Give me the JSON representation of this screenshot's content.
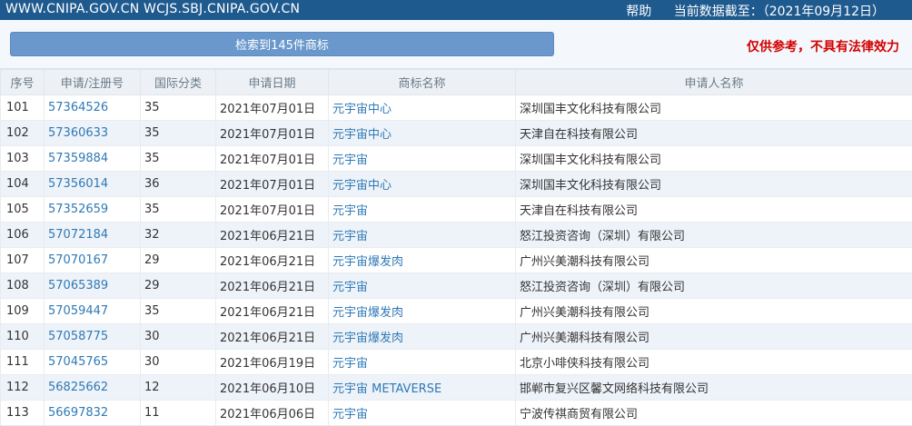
{
  "topbar": {
    "site": "WWW.CNIPA.GOV.CN WCJS.SBJ.CNIPA.GOV.CN",
    "help": "帮助",
    "data_as_of": "当前数据截至：（2021年09月12日）"
  },
  "result": {
    "count_label": "检索到145件商标",
    "disclaimer": "仅供参考，不具有法律效力"
  },
  "table": {
    "headers": [
      "序号",
      "申请/注册号",
      "国际分类",
      "申请日期",
      "商标名称",
      "申请人名称"
    ],
    "rows": [
      {
        "no": "101",
        "reg": "57364526",
        "cls": "35",
        "date": "2021年07月01日",
        "name": "元宇宙中心",
        "applicant": "深圳国丰文化科技有限公司"
      },
      {
        "no": "102",
        "reg": "57360633",
        "cls": "35",
        "date": "2021年07月01日",
        "name": "元宇宙中心",
        "applicant": "天津自在科技有限公司"
      },
      {
        "no": "103",
        "reg": "57359884",
        "cls": "35",
        "date": "2021年07月01日",
        "name": "元宇宙",
        "applicant": "深圳国丰文化科技有限公司"
      },
      {
        "no": "104",
        "reg": "57356014",
        "cls": "36",
        "date": "2021年07月01日",
        "name": "元宇宙中心",
        "applicant": "深圳国丰文化科技有限公司"
      },
      {
        "no": "105",
        "reg": "57352659",
        "cls": "35",
        "date": "2021年07月01日",
        "name": "元宇宙",
        "applicant": "天津自在科技有限公司"
      },
      {
        "no": "106",
        "reg": "57072184",
        "cls": "32",
        "date": "2021年06月21日",
        "name": "元宇宙",
        "applicant": "怒江投资咨询（深圳）有限公司"
      },
      {
        "no": "107",
        "reg": "57070167",
        "cls": "29",
        "date": "2021年06月21日",
        "name": "元宇宙爆发肉",
        "applicant": "广州兴美潮科技有限公司"
      },
      {
        "no": "108",
        "reg": "57065389",
        "cls": "29",
        "date": "2021年06月21日",
        "name": "元宇宙",
        "applicant": "怒江投资咨询（深圳）有限公司"
      },
      {
        "no": "109",
        "reg": "57059447",
        "cls": "35",
        "date": "2021年06月21日",
        "name": "元宇宙爆发肉",
        "applicant": "广州兴美潮科技有限公司"
      },
      {
        "no": "110",
        "reg": "57058775",
        "cls": "30",
        "date": "2021年06月21日",
        "name": "元宇宙爆发肉",
        "applicant": "广州兴美潮科技有限公司"
      },
      {
        "no": "111",
        "reg": "57045765",
        "cls": "30",
        "date": "2021年06月19日",
        "name": "元宇宙",
        "applicant": "北京小啡侠科技有限公司"
      },
      {
        "no": "112",
        "reg": "56825662",
        "cls": "12",
        "date": "2021年06月10日",
        "name": "元宇宙 METAVERSE",
        "applicant": "邯郸市复兴区馨文网络科技有限公司"
      },
      {
        "no": "113",
        "reg": "56697832",
        "cls": "11",
        "date": "2021年06月06日",
        "name": "元宇宙",
        "applicant": "宁波传祺商贸有限公司"
      }
    ]
  }
}
